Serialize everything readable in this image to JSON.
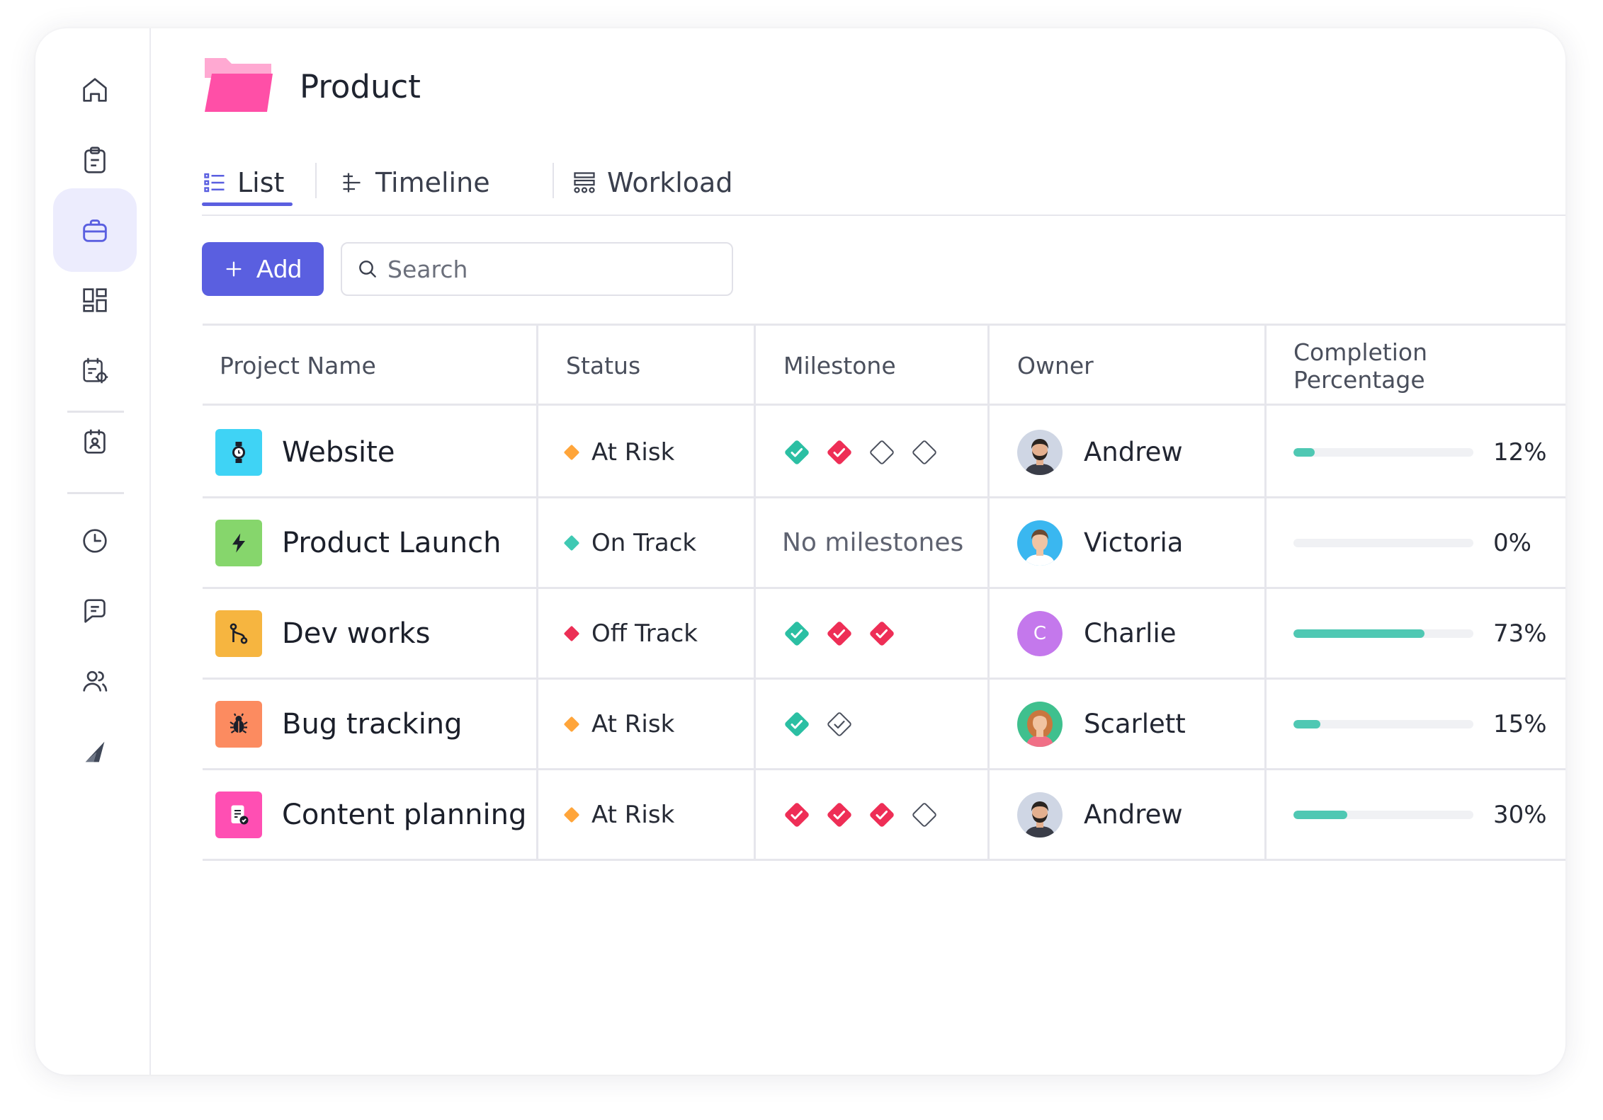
{
  "sidebar": {
    "items": [
      {
        "icon": "home-icon"
      },
      {
        "icon": "clipboard-icon"
      },
      {
        "icon": "briefcase-icon",
        "active": true
      },
      {
        "icon": "dashboard-icon"
      },
      {
        "icon": "calendar-settings-icon"
      },
      {
        "icon": "contact-card-icon"
      },
      {
        "icon": "clock-icon"
      },
      {
        "icon": "chat-icon"
      },
      {
        "icon": "users-icon"
      },
      {
        "icon": "logo-icon"
      }
    ]
  },
  "header": {
    "title": "Product",
    "folder_color": "#ff4fa7"
  },
  "tabs": [
    {
      "label": "List",
      "icon": "list-icon",
      "active": true
    },
    {
      "label": "Timeline",
      "icon": "timeline-icon"
    },
    {
      "label": "Workload",
      "icon": "workload-icon"
    }
  ],
  "toolbar": {
    "add_label": "Add",
    "search_placeholder": "Search"
  },
  "table": {
    "columns": [
      "Project Name",
      "Status",
      "Milestone",
      "Owner",
      "Completion Percentage"
    ],
    "no_milestones_text": "No milestones",
    "rows": [
      {
        "name": "Website",
        "icon": "watch-icon",
        "icon_bg": "#3fd3f5",
        "status": "At Risk",
        "status_color": "#ffa53a",
        "milestones": [
          "done-green",
          "done-red",
          "empty",
          "empty"
        ],
        "owner": "Andrew",
        "avatar": "andrew",
        "progress": 12,
        "progress_label": "12%"
      },
      {
        "name": "Product Launch",
        "icon": "bolt-icon",
        "icon_bg": "#86d66c",
        "status": "On Track",
        "status_color": "#3fc9b3",
        "milestones": [],
        "owner": "Victoria",
        "avatar": "victoria",
        "progress": 0,
        "progress_label": "0%"
      },
      {
        "name": "Dev works",
        "icon": "git-icon",
        "icon_bg": "#f6b540",
        "status": "Off Track",
        "status_color": "#ec2f55",
        "milestones": [
          "done-green",
          "done-red",
          "done-red"
        ],
        "owner": "Charlie",
        "avatar": "C",
        "avatar_bg": "#c478ec",
        "progress": 73,
        "progress_label": "73%"
      },
      {
        "name": "Bug tracking",
        "icon": "bug-icon",
        "icon_bg": "#fc8b60",
        "status": "At Risk",
        "status_color": "#ffa53a",
        "milestones": [
          "done-green",
          "outline-check"
        ],
        "owner": "Scarlett",
        "avatar": "scarlett",
        "progress": 15,
        "progress_label": "15%"
      },
      {
        "name": "Content planning",
        "icon": "doc-check-icon",
        "icon_bg": "#ff4fb3",
        "status": "At Risk",
        "status_color": "#ffa53a",
        "milestones": [
          "done-red",
          "done-red",
          "done-red",
          "empty"
        ],
        "owner": "Andrew",
        "avatar": "andrew",
        "progress": 30,
        "progress_label": "30%"
      }
    ]
  },
  "colors": {
    "accent": "#5a5fe0",
    "milestone_green": "#2bbfa3",
    "milestone_red": "#ee2e56",
    "progress": "#4fc8b3"
  }
}
